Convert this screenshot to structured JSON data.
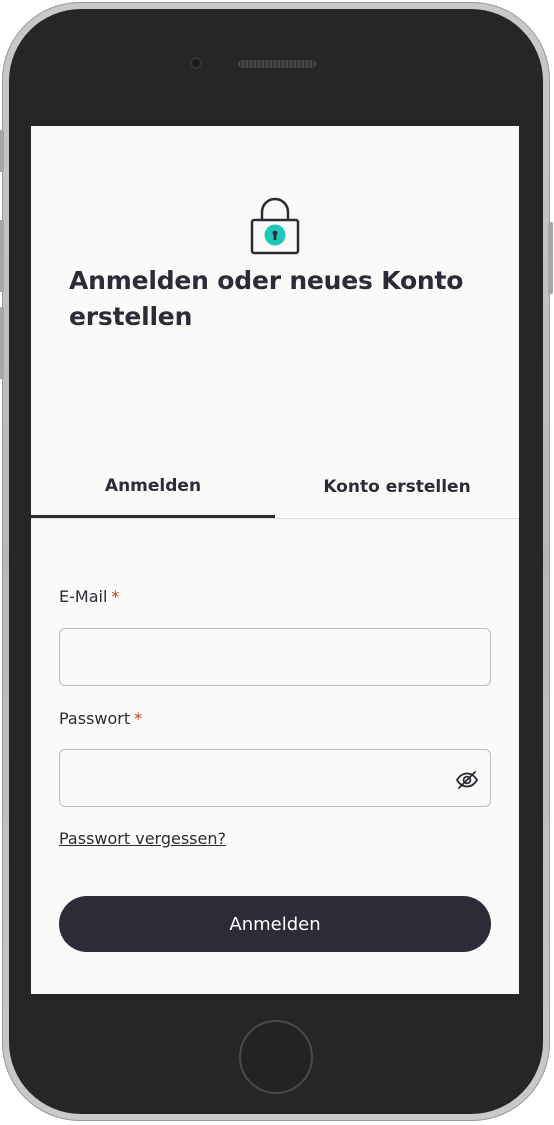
{
  "login": {
    "title": "Anmelden oder neues Konto erstellen",
    "tabs": [
      {
        "label": "Anmelden",
        "active": true
      },
      {
        "label": "Konto erstellen",
        "active": false
      }
    ],
    "email": {
      "label": "E-Mail",
      "required_mark": "*",
      "value": "",
      "placeholder": ""
    },
    "password": {
      "label": "Passwort",
      "required_mark": "*",
      "value": "",
      "placeholder": ""
    },
    "forgot_password": "Passwort vergessen?",
    "submit_label": "Anmelden"
  },
  "icons": {
    "lock": "lock-icon",
    "toggle_visibility": "eye-slash-icon"
  },
  "colors": {
    "primary": "#2f2a38",
    "accent": "#1fc7b8",
    "required": "#c0392b",
    "background": "#fbfaf8"
  }
}
